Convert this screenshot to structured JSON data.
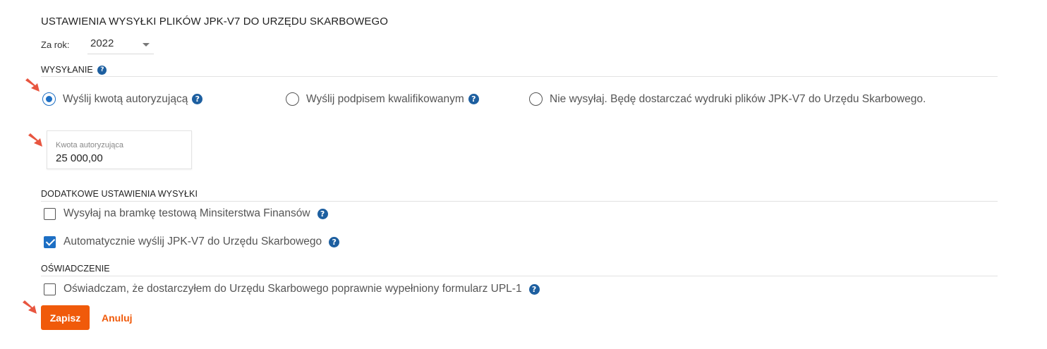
{
  "header": {
    "title": "USTAWIENIA WYSYŁKI PLIKÓW JPK-V7 DO URZĘDU SKARBOWEGO",
    "year_label": "Za rok:",
    "year_value": "2022"
  },
  "sending": {
    "title": "WYSYŁANIE",
    "options": [
      {
        "label": "Wyślij kwotą autoryzującą",
        "selected": true
      },
      {
        "label": "Wyślij podpisem kwalifikowanym",
        "selected": false
      },
      {
        "label": "Nie wysyłaj. Będę dostarczać wydruki plików JPK-V7 do Urzędu Skarbowego.",
        "selected": false
      }
    ],
    "amount_label": "Kwota autoryzująca",
    "amount_value": "25 000,00"
  },
  "additional": {
    "title": "DODATKOWE USTAWIENIA WYSYŁKI",
    "items": [
      {
        "label": "Wysyłaj na bramkę testową Minsiterstwa Finansów",
        "checked": false
      },
      {
        "label": "Automatycznie wyślij JPK-V7 do Urzędu Skarbowego",
        "checked": true
      }
    ]
  },
  "statement": {
    "title": "OŚWIADCZENIE",
    "items": [
      {
        "label": "Oświadczam, że dostarczyłem do Urzędu Skarbowego poprawnie wypełniony formularz UPL-1",
        "checked": false
      }
    ]
  },
  "actions": {
    "save_label": "Zapisz",
    "cancel_label": "Anuluj"
  },
  "icons": {
    "help": "?"
  },
  "colors": {
    "accent": "#f05a0a",
    "selection": "#1d6fc4",
    "help_icon": "#1d5fa0",
    "annotation_arrow": "#e8553f"
  }
}
